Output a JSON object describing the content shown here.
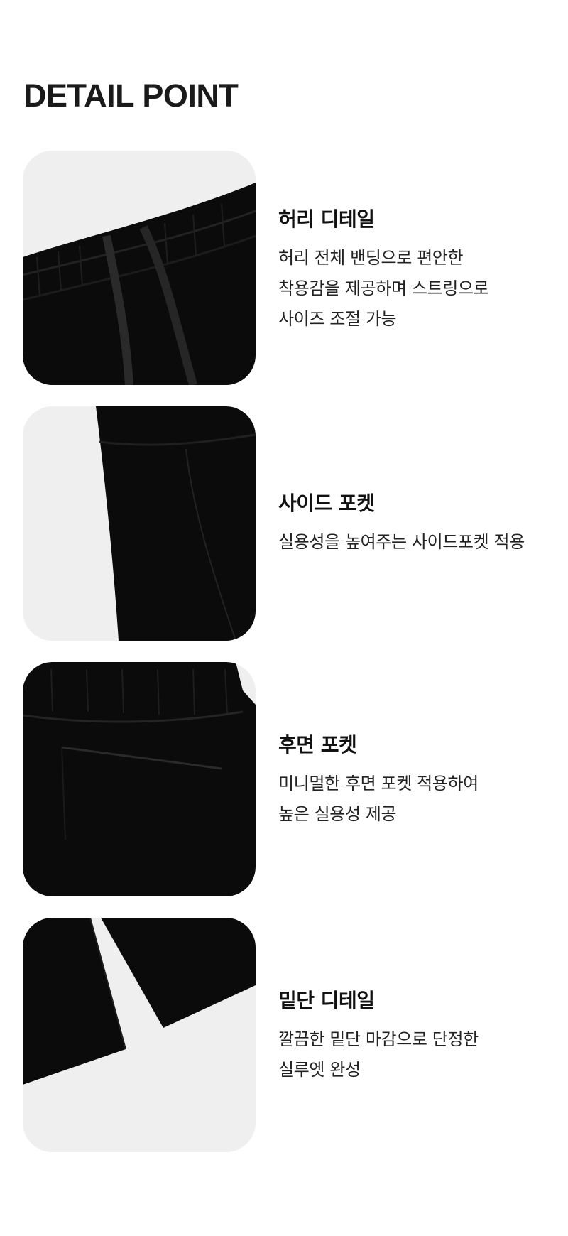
{
  "page_title": "DETAIL POINT",
  "details": [
    {
      "title": "허리 디테일",
      "description": "허리 전체 밴딩으로 편안한\n착용감을 제공하며 스트링으로\n사이즈 조절 가능"
    },
    {
      "title": "사이드 포켓",
      "description": "실용성을 높여주는 사이드포켓 적용"
    },
    {
      "title": "후면 포켓",
      "description": "미니멀한 후면 포켓 적용하여\n높은 실용성 제공"
    },
    {
      "title": "밑단 디테일",
      "description": "깔끔한 밑단 마감으로 단정한\n실루엣 완성"
    }
  ]
}
